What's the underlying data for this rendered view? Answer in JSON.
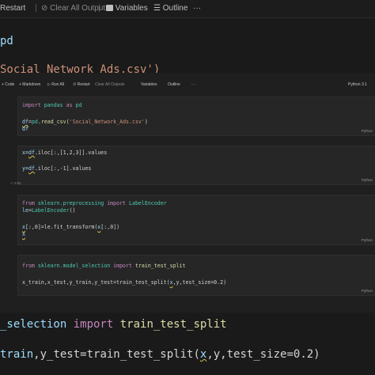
{
  "bg_toolbar": {
    "restart": "Restart",
    "clear_all": "Clear All Outputs",
    "variables": "Variables",
    "outline": "Outline",
    "more": "···"
  },
  "bg_code": {
    "line1": "pd",
    "line2": "Social_Network_Ads.csv')",
    "line3_a": "_selection ",
    "line3_kw": "import",
    "line3_b": " train_test_split",
    "line4_a": "train",
    "line4_b": ",y_test=train_test_split(",
    "line4_x": "x",
    "line4_c": ",y,test_size=0.2)"
  },
  "notebook_toolbar": {
    "code": "+ Code",
    "markdown": "+ Markdown",
    "run_all": "▷ Run All",
    "restart": "↺ Restart",
    "clear_all": "Clear All Outputs",
    "variables": "Variables",
    "outline": "Outline",
    "more": "···",
    "kernel": "Python 3.1"
  },
  "cells": {
    "c1": {
      "l1_kw": "import",
      "l1_mod": " pandas ",
      "l1_kw2": "as",
      "l1_alias": " pd",
      "l2_a": "df",
      "l2_b": "=",
      "l2_c": "pd",
      "l2_d": ".read_csv(",
      "l2_str": "'Social_Network_Ads.csv'",
      "l2_e": ")",
      "l3": "df",
      "lang": "Python"
    },
    "c2": {
      "l1_a": "x",
      "l1_b": "=",
      "l1_c": "df",
      "l1_d": ".iloc[:,[1,2,3]].values",
      "l2_a": "y",
      "l2_b": "=",
      "l2_c": "df",
      "l2_d": ".iloc[:,-1].values",
      "gutter": "0.0s",
      "lang": "Python"
    },
    "c3": {
      "l1_kw": "from",
      "l1_mod": " sklearn.preprocessing ",
      "l1_kw2": "import",
      "l1_cls": " LabelEncoder",
      "l2_a": "le",
      "l2_b": "=",
      "l2_c": "LabelEncoder",
      "l2_d": "()",
      "l3_a": "x",
      "l3_b": "[:,0]=le.fit_transform(",
      "l3_c": "x",
      "l3_d": "[:,0])",
      "l4": "x",
      "lang": "Python"
    },
    "c4": {
      "l1_kw": "from",
      "l1_mod": " sklearn.model_selection ",
      "l1_kw2": "import",
      "l1_fn": " train_test_split",
      "l2_a": "x_train,x_test,y_train,y_test=train_test_split(",
      "l2_x": "x",
      "l2_b": ",y,test_size=0.2)",
      "lang": "Python"
    }
  },
  "colors": {
    "background": "#1a1a1a",
    "cell": "#262626",
    "keyword": "#c586c0",
    "string": "#ce9178",
    "variable": "#9cdcfe",
    "function": "#dcdcaa"
  }
}
